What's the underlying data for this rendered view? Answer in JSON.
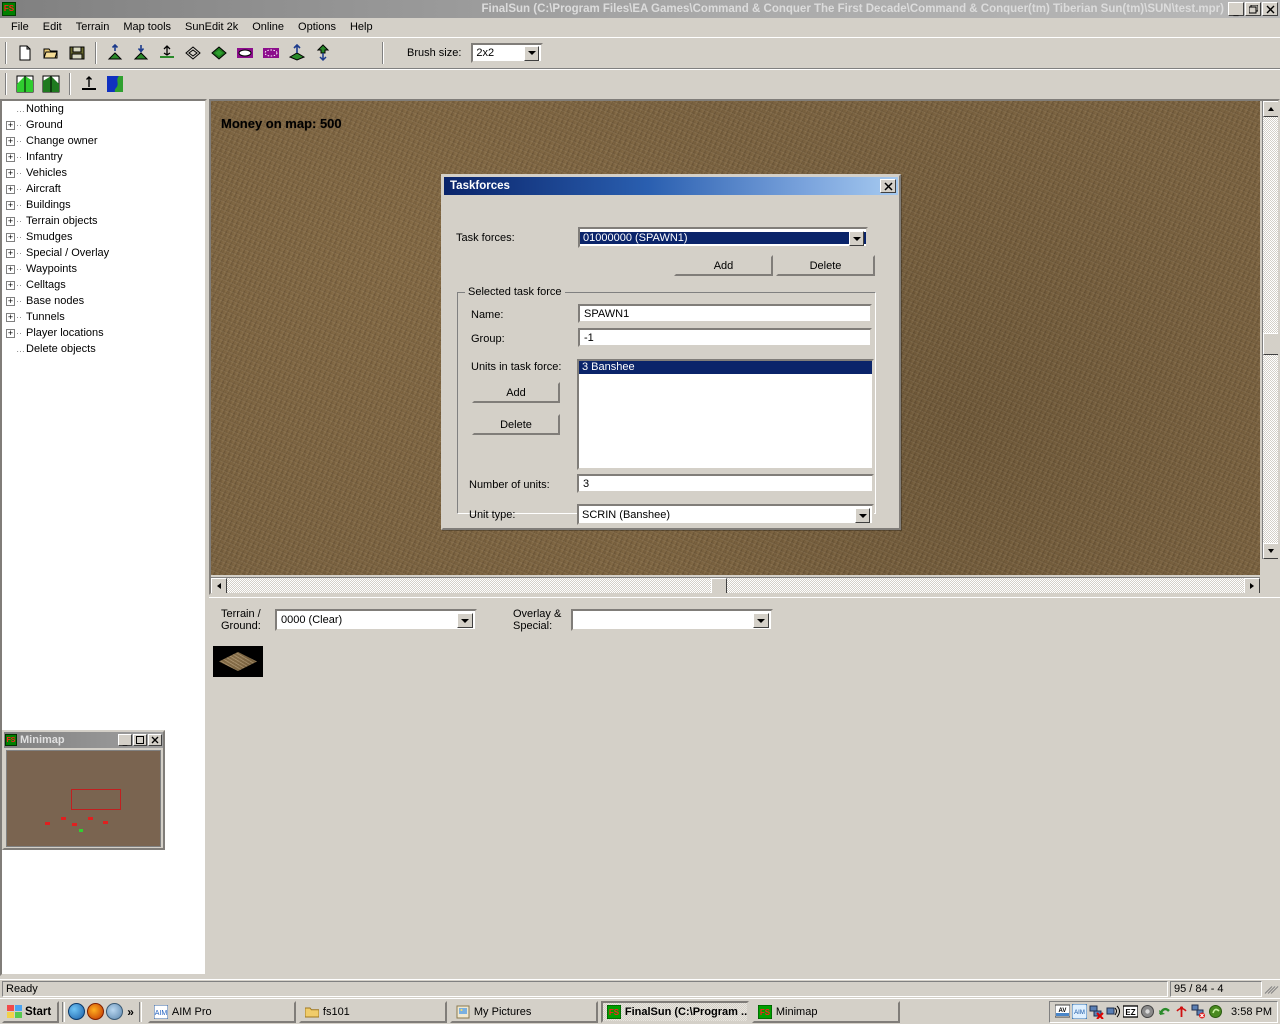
{
  "window": {
    "title": "FinalSun (C:\\Program Files\\EA Games\\Command & Conquer The First Decade\\Command & Conquer(tm) Tiberian Sun(tm)\\SUN\\test.mpr)",
    "icon_label": "FS",
    "minimize_label": "_",
    "restore_label": "❐",
    "close_label": "✕"
  },
  "menu": {
    "items": [
      {
        "label": "File"
      },
      {
        "label": "Edit"
      },
      {
        "label": "Terrain"
      },
      {
        "label": "Map tools"
      },
      {
        "label": "SunEdit 2k"
      },
      {
        "label": "Online"
      },
      {
        "label": "Options"
      },
      {
        "label": "Help"
      }
    ]
  },
  "toolbar": {
    "row1_icons": [
      {
        "name": "new-file-icon"
      },
      {
        "name": "open-folder-icon"
      },
      {
        "name": "save-disk-icon"
      },
      {
        "name": "raise-ground-icon"
      },
      {
        "name": "lower-ground-icon"
      },
      {
        "name": "flatten-ground-icon"
      },
      {
        "name": "tile-outline-icon"
      },
      {
        "name": "tile-filled-icon"
      },
      {
        "name": "overlay-ellipse-icon"
      },
      {
        "name": "overlay-ellipse-dotted-icon"
      },
      {
        "name": "raise-tiberium-icon"
      },
      {
        "name": "lower-tiberium-icon"
      }
    ],
    "row2_icons": [
      {
        "name": "slope-left-icon"
      },
      {
        "name": "slope-right-icon"
      },
      {
        "name": "raise-cliff-icon"
      },
      {
        "name": "water-icon"
      }
    ],
    "brush_size_label": "Brush size:",
    "brush_size_value": "2x2"
  },
  "tree": {
    "items": [
      {
        "label": "Nothing",
        "expandable": false
      },
      {
        "label": "Ground",
        "expandable": true
      },
      {
        "label": "Change owner",
        "expandable": true
      },
      {
        "label": "Infantry",
        "expandable": true
      },
      {
        "label": "Vehicles",
        "expandable": true
      },
      {
        "label": "Aircraft",
        "expandable": true
      },
      {
        "label": "Buildings",
        "expandable": true
      },
      {
        "label": "Terrain objects",
        "expandable": true
      },
      {
        "label": "Smudges",
        "expandable": true
      },
      {
        "label": "Special / Overlay",
        "expandable": true
      },
      {
        "label": "Waypoints",
        "expandable": true
      },
      {
        "label": "Celltags",
        "expandable": true
      },
      {
        "label": "Base nodes",
        "expandable": true
      },
      {
        "label": "Tunnels",
        "expandable": true
      },
      {
        "label": "Player locations",
        "expandable": true
      },
      {
        "label": "Delete objects",
        "expandable": false
      }
    ],
    "expand_glyph": "+"
  },
  "map": {
    "money_overlay": "Money on map: 500",
    "terrain_color": "#7a6240"
  },
  "tile_panel": {
    "terrain_label_line1": "Terrain /",
    "terrain_label_line2": "Ground:",
    "terrain_value": "0000 (Clear)",
    "overlay_label_line1": "Overlay &",
    "overlay_label_line2": "Special:",
    "overlay_value": ""
  },
  "minimap": {
    "title": "Minimap",
    "icon_label": "FS",
    "minimize_label": "_",
    "maximize_label": "□",
    "close_label": "✕",
    "viewport_color": "#c02020",
    "background_color": "#7a6450"
  },
  "dialog": {
    "title": "Taskforces",
    "close_label": "✕",
    "taskforces_label": "Task forces:",
    "taskforces_value": "01000000 (SPAWN1)",
    "add_button": "Add",
    "delete_button": "Delete",
    "group_legend": "Selected task force",
    "name_label": "Name:",
    "name_value": "SPAWN1",
    "group_label": "Group:",
    "group_value": "-1",
    "units_label": "Units in task force:",
    "units_add_button": "Add",
    "units_delete_button": "Delete",
    "units_list": [
      {
        "label": "3 Banshee",
        "selected": true
      }
    ],
    "number_label": "Number of units:",
    "number_value": "3",
    "unittype_label": "Unit type:",
    "unittype_value": "SCRIN (Banshee)"
  },
  "statusbar": {
    "message": "Ready",
    "coordinates": "95 / 84 - 4"
  },
  "taskbar": {
    "start_label": "Start",
    "quick_launch": [
      {
        "name": "media-player-icon"
      },
      {
        "name": "browser-icon"
      },
      {
        "name": "messenger-icon"
      }
    ],
    "quick_chevron": "»",
    "tasks": [
      {
        "label": "AIM Pro",
        "icon": "aim-icon",
        "active": false
      },
      {
        "label": "fs101",
        "icon": "folder-icon",
        "active": false
      },
      {
        "label": "My Pictures",
        "icon": "pictures-folder-icon",
        "active": false
      },
      {
        "label": "FinalSun (C:\\Program ...",
        "icon": "finalsun-icon",
        "active": true
      },
      {
        "label": "Minimap",
        "icon": "finalsun-icon",
        "active": false
      }
    ],
    "tray_icons": [
      {
        "name": "antivirus-icon"
      },
      {
        "name": "aim-tray-icon"
      },
      {
        "name": "network-disconnected-icon"
      },
      {
        "name": "network-speaker-icon"
      },
      {
        "name": "ez-icon"
      },
      {
        "name": "volume-icon"
      },
      {
        "name": "update-icon"
      },
      {
        "name": "wireless-signal-icon"
      },
      {
        "name": "network-config-icon"
      },
      {
        "name": "nvidia-icon"
      }
    ],
    "clock": "3:58 PM"
  }
}
